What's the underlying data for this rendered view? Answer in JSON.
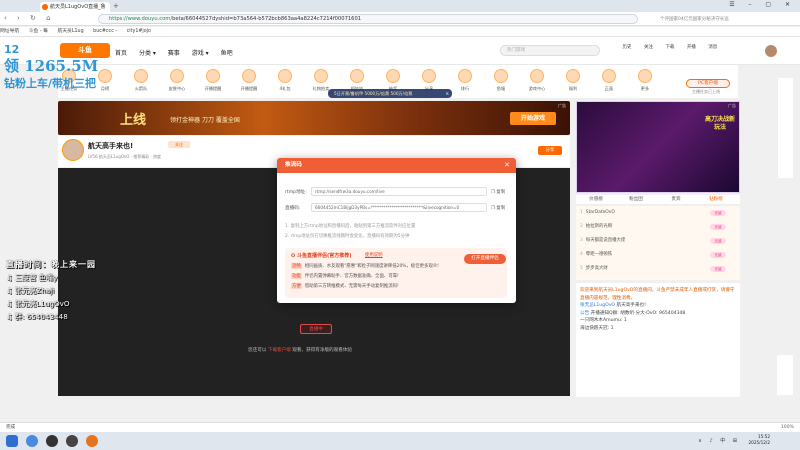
{
  "browser": {
    "tab_title": "航天员L1ugOvO直播_鲁",
    "new_tab": "+",
    "window_controls": "☰ – ▢ ✕",
    "nav_buttons": "‹ › ↻ ⌂",
    "url_secure": "https://www.douyu.com/",
    "url_rest": "beta/66044527dyshid=b73a564-b572bcb863aa4a8224c7214f00071601",
    "url_right": "个评国家04亿元国家分秘决守长远",
    "bookmarks": [
      "网址导航",
      "斗鱼 - 每",
      "航天员L1ug",
      "buc#ccc -",
      "city1#jojo"
    ]
  },
  "site": {
    "logo": "斗鱼",
    "nav": [
      "首页",
      "分类 ▾",
      "赛事",
      "游戏 ▾",
      "鱼吧"
    ],
    "search_placeholder": "热门游戏",
    "header_icons": [
      "历史",
      "关注",
      "下载",
      "开播",
      "消息"
    ]
  },
  "giftbar": {
    "items": [
      "主播任务",
      "月榜",
      "火箭队",
      "皮肤中心",
      "开播提醒",
      "开播提醒",
      "4礼包",
      "礼物拍卖",
      "抓娃娃",
      "抽奖",
      "分享",
      "排行",
      "鱼塘",
      "游戏中心",
      "福利",
      "正面",
      "更多"
    ],
    "float_text": "5日开票/鲁机甲 5000万/倍票 500万/倍票",
    "float_close": "✕",
    "pc_client": "PC客户端",
    "pc_sub": "主播任务已上线"
  },
  "banner": {
    "big": "上线",
    "text": "领打金神器 刀刀 覆盖全国",
    "button": "开始游戏",
    "ad": "广告"
  },
  "streamer": {
    "name": "航天高手来也!",
    "tag": "关注",
    "sub": "LV56 航天员L1ugOvO · 推荐精彩 · 热度",
    "right_btn": "分享"
  },
  "video": {
    "live_btn": "直播中",
    "tip_prefix": "您还可以 ",
    "tip_highlight": "下载客户端",
    "tip_suffix": " 观看，获得有净版的观看体验"
  },
  "overlay": {
    "top_num": "12",
    "top_big": "领 1265.5M",
    "top_line": "钻粉上车/带机三把",
    "heading": "直播时间：晚上来一园",
    "lines": [
      "♫ 三度营 鱼嘴y",
      "♫ 张元亮Zhaji",
      "♫ 张元亮L1ugOvO",
      "♫ 群: 654043448"
    ]
  },
  "right": {
    "ad_text": "高刀决战新玩法",
    "ad_label": "广告",
    "tabs": [
      "价值榜",
      "粉丝团",
      "贵宾",
      "钻粉榜"
    ],
    "list": [
      {
        "n": "1",
        "name": "StarDateOvO",
        "badge": "无敌"
      },
      {
        "n": "2",
        "name": "帕拉斯的光啊",
        "badge": "无敌"
      },
      {
        "n": "3",
        "name": "每天都是说直播大佬",
        "badge": "无敌"
      },
      {
        "n": "4",
        "name": "零距一德顿铁",
        "badge": "无敌"
      },
      {
        "n": "5",
        "name": "步步高大财",
        "badge": "无敌"
      }
    ],
    "chat": {
      "sys": "欢迎来到航天员L1ugOvO的直播间，斗鱼严禁未成年人直播或打赏，请遵守直播内容规范，理性消费。",
      "lines": [
        {
          "u": "张无忌L1ugOvO",
          "t": "航天高手来也!"
        },
        {
          "u": "公告",
          "t": "开播通知Q群: 胡数听·分大·OvO: 965404348"
        },
        {
          "u": "",
          "t": "一只网木木Amumu: 1"
        },
        {
          "u": "",
          "t": "海边快跑天冠: 1"
        }
      ]
    }
  },
  "modal": {
    "title": "推流码",
    "close": "✕",
    "rtmp_label": "rtmp地址:",
    "rtmp_value": "rtmp://sendfrw3a.douyu.com/live",
    "key_label": "直播码:",
    "key_value": "6604452mC1BIjgD3yPBs=*************************&livecognition=0",
    "copy": "复制",
    "note1": "1. 复制上方rtmp地址和直播码后，粘贴到第三方推流软件对应位置",
    "note2": "2. rtmp地址仅在切换推流线路时会变化，直播码有效期为5分钟",
    "promo_title": "斗鱼直播伴侣(官方推荐)",
    "promo_link": "使用说明",
    "promo_open": "打开直播伴侣",
    "items": [
      {
        "tag": "流畅",
        "text": "相同画质、水友观看\"愿惠\"和粒子网速度讲降低20%，极佳更多观众!"
      },
      {
        "tag": "功能",
        "text": "伴侣内置弹幕助手、官方数据准确、全面、可靠!"
      },
      {
        "tag": "方便",
        "text": "借助第三方转推模式、无需每天手动复制推流码!"
      }
    ]
  },
  "statusbar": {
    "left": "完成",
    "zoom": "100%"
  },
  "taskbar": {
    "time": "15:52",
    "date": "2025/12/2",
    "tray": "∧ ♪ 中 ⊞"
  },
  "colors": {
    "accent": "#f05e35",
    "brand": "#ff7700",
    "video_bg": "#222222"
  }
}
